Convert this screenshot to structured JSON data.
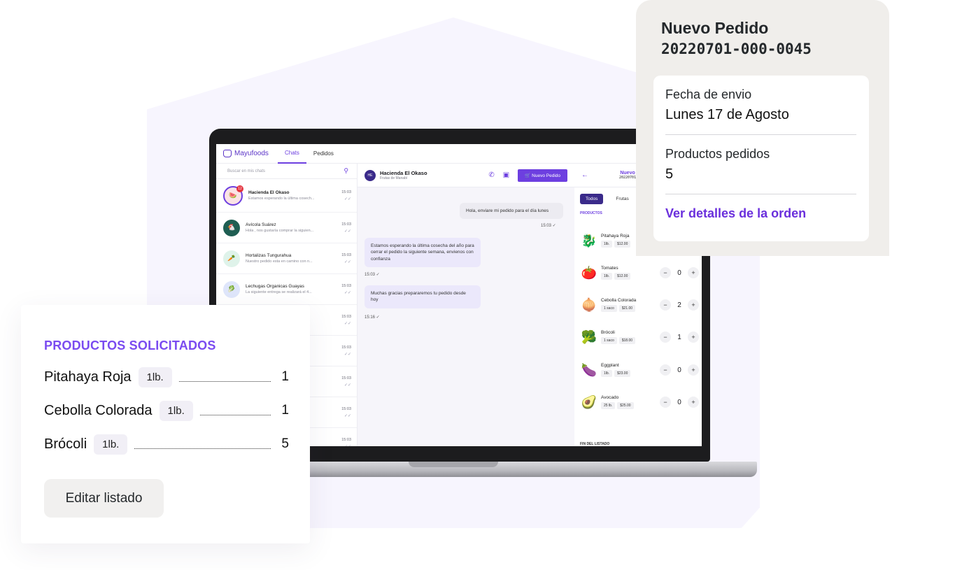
{
  "app": {
    "brand": "Mayufoods",
    "tabs": [
      "Chats",
      "Pedidos"
    ]
  },
  "chat_list": {
    "search_placeholder": "Buscar en mis chats",
    "items": [
      {
        "name": "Hacienda El Okaso",
        "preview": "Estamos esperando la última cosech...",
        "time": "15:03",
        "badge": "12",
        "avatar": "🍉",
        "avatar_bg": "#fbe3e6"
      },
      {
        "name": "Avícola Suárez",
        "preview": "Hola , nos gustaría comprar la siguien...",
        "time": "15:03",
        "avatar": "🐔",
        "avatar_bg": "#1f5e52"
      },
      {
        "name": "Hortalizas Tungurahua",
        "preview": "Nuestro pedido esta en camino con n...",
        "time": "15:03",
        "avatar": "🥕",
        "avatar_bg": "#dff3ea"
      },
      {
        "name": "Lechugas Organicas Guayas",
        "preview": "La siguiente entrega se realizará el 4...",
        "time": "15:03",
        "avatar": "🥬",
        "avatar_bg": "#dfe6fb"
      },
      {
        "name": "",
        "preview": "siguien...",
        "time": "15:03",
        "avatar": "",
        "avatar_bg": "#eeeeee"
      },
      {
        "name": "",
        "preview": "con n...",
        "time": "15:03",
        "avatar": "",
        "avatar_bg": "#eeeeee"
      },
      {
        "name": "",
        "preview": "el 4...",
        "time": "15:03",
        "avatar": "",
        "avatar_bg": "#eeeeee"
      },
      {
        "name": "",
        "preview": "siguien...",
        "time": "15:03",
        "avatar": "",
        "avatar_bg": "#eeeeee"
      },
      {
        "name": "",
        "preview": "",
        "time": "15:03",
        "avatar": "",
        "avatar_bg": "#eeeeee"
      }
    ]
  },
  "conversation": {
    "initials": "HE",
    "name": "Hacienda El Okaso",
    "subtitle": "Frutas de Manabí",
    "new_order_label": "Nuevo Pedido",
    "messages": [
      {
        "text": "Hola, enviare mi pedido para el día lunes",
        "time": "15:03 ✓"
      },
      {
        "text": "Estamos esperando la última cosecha del año para cerrar el pedido la siguiente semana, envienos con confianza",
        "time": "15:03 ✓"
      },
      {
        "text": "Muchas gracias prepararemos tu pedido desde hoy",
        "time": "15:16 ✓"
      }
    ]
  },
  "products_panel": {
    "title": "Nuevo",
    "code": "20220701",
    "filters": [
      "Todos",
      "Frutas"
    ],
    "section_label": "PRODUCTOS",
    "end_label": "FIN DEL LISTADO",
    "items": [
      {
        "name": "Pitahaya Roja",
        "unit": "1lb.",
        "price": "$12.00",
        "qty": "",
        "emoji": "🐉"
      },
      {
        "name": "Tomates",
        "unit": "1lb.",
        "price": "$12.00",
        "qty": "0",
        "emoji": "🍅"
      },
      {
        "name": "Cebolla Colorada",
        "unit": "1 saco",
        "price": "$21.00",
        "qty": "2",
        "emoji": "🧅"
      },
      {
        "name": "Brócoli",
        "unit": "1 saco",
        "price": "$18.00",
        "qty": "1",
        "emoji": "🥦"
      },
      {
        "name": "Eggplant",
        "unit": "1lb.",
        "price": "$23.00",
        "qty": "0",
        "emoji": "🍆"
      },
      {
        "name": "Avocado",
        "unit": "25 lb.",
        "price": "$25.00",
        "qty": "0",
        "emoji": "🥑"
      }
    ]
  },
  "order_card": {
    "title": "Nuevo Pedido",
    "code": "20220701-000-0045",
    "ship_label": "Fecha de envio",
    "ship_value": "Lunes 17 de Agosto",
    "products_label": "Productos pedidos",
    "products_value": "5",
    "details_link": "Ver detalles de la orden"
  },
  "requested_card": {
    "title": "PRODUCTOS SOLICITADOS",
    "items": [
      {
        "name": "Pitahaya Roja",
        "unit": "1lb.",
        "qty": "1"
      },
      {
        "name": "Cebolla Colorada",
        "unit": "1lb.",
        "qty": "1"
      },
      {
        "name": "Brócoli",
        "unit": "1lb.",
        "qty": "5"
      }
    ],
    "edit_label": "Editar listado"
  }
}
